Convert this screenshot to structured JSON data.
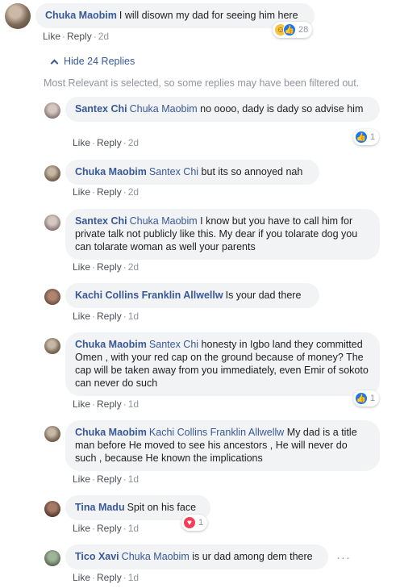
{
  "main_comment": {
    "author": "Chuka Maobim",
    "text": "I will disown my dad for seeing him here",
    "like": "Like",
    "reply": "Reply",
    "time": "2d",
    "reaction_count": "28",
    "reaction_icons": [
      "haha-icon",
      "like-icon"
    ]
  },
  "thread": {
    "hide_label": "Hide 24 Replies",
    "filter_note": "Most Relevant is selected, so some replies may have been filtered out."
  },
  "replies": [
    {
      "author": "Santex Chi",
      "mention": "Chuka Maobim",
      "text": " no oooo, dady is dady so advise him",
      "like": "Like",
      "reply": "Reply",
      "time": "2d",
      "reaction_count": "1"
    },
    {
      "author": "Chuka Maobim",
      "mention": "Santex Chi",
      "text": " but its so annoyed nah",
      "like": "Like",
      "reply": "Reply",
      "time": "2d"
    },
    {
      "author": "Santex Chi",
      "mention": "Chuka Maobim",
      "text": " I know but you have to call him for private talk not publicly like this. My dear if you tolarate dog you can tolarate woman as well your parents",
      "like": "Like",
      "reply": "Reply",
      "time": "2d"
    },
    {
      "author": "Kachi Collins Franklin Allwellw",
      "mention": "",
      "text": "Is your dad there",
      "like": "Like",
      "reply": "Reply",
      "time": "1d"
    },
    {
      "author": "Chuka Maobim",
      "mention": "Santex Chi",
      "text": " honesty in Igbo land they committed Omen , with your red cap on the ground because of money? The cap will be taken away from you immediately, even Emir of sokoto can never do such",
      "like": "Like",
      "reply": "Reply",
      "time": "1d",
      "reaction_count": "1"
    },
    {
      "author": "Chuka Maobim",
      "mention": "Kachi Collins Franklin Allwellw",
      "text": " My dad is a title man before He moved to see his ancestors , He will never do such , because He known the implications",
      "like": "Like",
      "reply": "Reply",
      "time": "1d"
    },
    {
      "author": "Tina Madu",
      "mention": "",
      "text": "Spit on his face",
      "like": "Like",
      "reply": "Reply",
      "time": "1d",
      "reaction_count": "1"
    },
    {
      "author": "Tico Xavi",
      "mention": "Chuka Maobim",
      "text": " is ur dad among dem there",
      "like": "Like",
      "reply": "Reply",
      "time": "1d"
    }
  ],
  "colors": {
    "link": "#385898",
    "bubble": "#f2f3f5",
    "like_blue": "#1877f2",
    "love_red": "#f33e58"
  }
}
